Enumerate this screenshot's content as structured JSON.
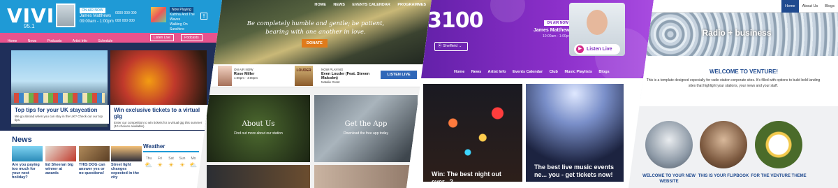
{
  "vivid": {
    "logo": "VIVID",
    "frequency": "95.1",
    "on_air_badge": "ON AIR NOW",
    "host_name": "James Matthews",
    "host_time": "09:00am - 1:00pm",
    "contact_lines": [
      "0000 000 000",
      "000 000 000"
    ],
    "now_playing_badge": "Now Playing",
    "now_playing_title": "Katrina And The Waves",
    "now_playing_song": "Walking On Sunshine",
    "nav": [
      "Home",
      "News",
      "Podcasts",
      "Artist Info",
      "Schedule"
    ],
    "listen_live": "Listen Live",
    "podcasts_button": "Podcasts",
    "card1_title": "Top tips for your UK staycation",
    "card1_desc": "We go abroad when you can stay in the UK? Check our our top tips.",
    "card2_title": "Win exclusive tickets to a virtual gig",
    "card2_desc": "Enter our competition to win tickets for a virtual gig this summer (10 choices available)",
    "news_heading": "News",
    "news_items": [
      "Are you paying too much for your next holiday?",
      "Ed Sheeran big winner at awards",
      "THIS DOG can answer yes or no questions!",
      "Street light changes expected in the city"
    ],
    "weather_heading": "Weather",
    "weather_days": [
      "Thu",
      "Fri",
      "Sat",
      "Sun",
      "Mo"
    ]
  },
  "scenic": {
    "nav": [
      "HOME",
      "NEWS",
      "EVENTS CALENDAR",
      "PROGRAMMES"
    ],
    "quote": "Be completely humble and gentle; be patient, bearing with one another in love.",
    "donate": "DONATE",
    "on_air_label": "ON AIR NOW",
    "host_name": "Rose Miller",
    "host_time": "1:00pm - 4:00pm",
    "album_text": "LOUDER",
    "now_playing_label": "NOW PLAYING",
    "song": "Even Louder (Feat. Steven Malcolm)",
    "artist": "Natalie Grant",
    "listen_live": "LISTEN LIVE",
    "tile1_title": "About Us",
    "tile1_sub": "Find out more about our station",
    "tile2_title": "Get the App",
    "tile2_sub": "Download the free app today"
  },
  "station3100": {
    "logo": "3100",
    "on_air_badge": "ON AIR NOW",
    "host_name": "James Matthews",
    "host_time": "10:00am - 1:00pm",
    "listen_live": "Listen Live",
    "location": "Sheffield",
    "nav": [
      "Home",
      "News",
      "Artist Info",
      "Events Calendar",
      "Club",
      "Music Playlists",
      "Blogs"
    ],
    "tile1_caption": "Win: The best night out ever...?",
    "tile2_caption": "The best live music events ne... you - get tickets now!"
  },
  "venture": {
    "menu": [
      "Home",
      "About Us",
      "Blogs"
    ],
    "hero_title": "Radio + business",
    "welcome_heading": "WELCOME TO VENTURE!",
    "welcome_text": "This is a template designed especially for radio station corporate sites. It's filled with options to build bold landing sites that highlight your stations, your news and your staff.",
    "circles": [
      "WELCOME TO YOUR NEW WEBSITE",
      "THIS IS YOUR FLIPBOOK",
      "FOR THE VENTURE THEME"
    ]
  },
  "colors": {
    "vivid_blue": "#1f9ad6",
    "vivid_pink": "#e8538d",
    "scenic_button": "#2f67b8",
    "purple": "#7a26bf",
    "venture_navy": "#1f4a8f"
  }
}
